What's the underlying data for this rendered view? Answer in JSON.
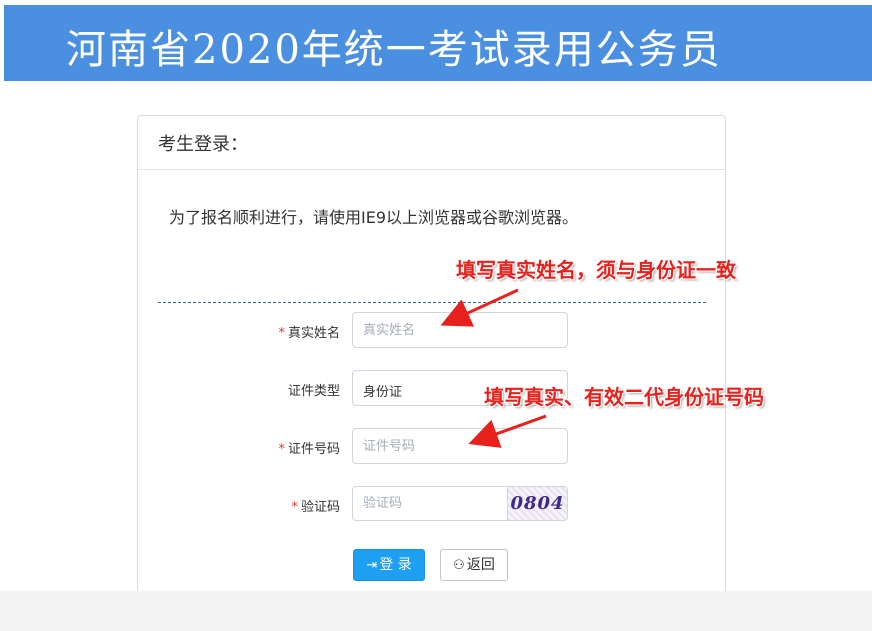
{
  "banner": {
    "title": "河南省2020年统一考试录用公务员"
  },
  "panel": {
    "header": "考生登录：",
    "notice": "为了报名顺利进行，请使用IE9以上浏览器或谷歌浏览器。"
  },
  "form": {
    "name": {
      "label": "真实姓名",
      "placeholder": "真实姓名",
      "required": true
    },
    "id_type": {
      "label": "证件类型",
      "value": "身份证",
      "required": false
    },
    "id_number": {
      "label": "证件号码",
      "placeholder": "证件号码",
      "required": true
    },
    "captcha": {
      "label": "验证码",
      "placeholder": "验证码",
      "image_text": "0804",
      "required": true
    },
    "required_mark": "*"
  },
  "buttons": {
    "login_label": "登 录",
    "login_icon": "sign-in-icon",
    "back_label": "返回",
    "back_icon": "binoculars-icon"
  },
  "annotations": {
    "name_hint": "填写真实姓名，须与身份证一致",
    "id_hint": "填写真实、有效二代身份证号码"
  },
  "colors": {
    "banner": "#4a8fe0",
    "primary_button": "#1e9ff2",
    "required_mark": "#e2382b",
    "annotation": "#e8211c",
    "divider": "#2e6aa8"
  }
}
